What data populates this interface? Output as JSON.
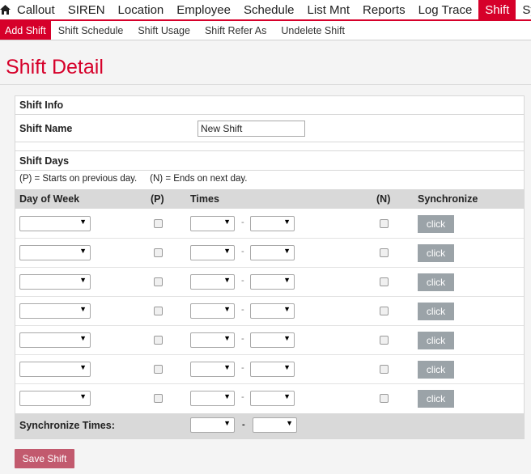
{
  "nav": {
    "home_icon": "home-icon",
    "items": [
      {
        "label": "Callout",
        "active": false
      },
      {
        "label": "SIREN",
        "active": false
      },
      {
        "label": "Location",
        "active": false
      },
      {
        "label": "Employee",
        "active": false
      },
      {
        "label": "Schedule",
        "active": false
      },
      {
        "label": "List Mnt",
        "active": false
      },
      {
        "label": "Reports",
        "active": false
      },
      {
        "label": "Log Trace",
        "active": false
      },
      {
        "label": "Shift",
        "active": true
      },
      {
        "label": "Sys Ac",
        "active": false
      }
    ]
  },
  "subnav": {
    "items": [
      {
        "label": "Add Shift",
        "active": true
      },
      {
        "label": "Shift Schedule",
        "active": false
      },
      {
        "label": "Shift Usage",
        "active": false
      },
      {
        "label": "Shift Refer As",
        "active": false
      },
      {
        "label": "Undelete Shift",
        "active": false
      }
    ]
  },
  "page": {
    "title": "Shift Detail"
  },
  "shift_info": {
    "heading": "Shift Info",
    "name_label": "Shift Name",
    "name_value": "New Shift"
  },
  "shift_days": {
    "heading": "Shift Days",
    "note": "(P) = Starts on previous day.     (N) = Ends on next day.",
    "columns": {
      "day": "Day of Week",
      "p": "(P)",
      "times": "Times",
      "n": "(N)",
      "sync": "Synchronize"
    },
    "time_separator": "-",
    "rows": [
      {
        "day": "",
        "start": "",
        "end": "",
        "p": false,
        "n": false,
        "button": "click"
      },
      {
        "day": "",
        "start": "",
        "end": "",
        "p": false,
        "n": false,
        "button": "click"
      },
      {
        "day": "",
        "start": "",
        "end": "",
        "p": false,
        "n": false,
        "button": "click"
      },
      {
        "day": "",
        "start": "",
        "end": "",
        "p": false,
        "n": false,
        "button": "click"
      },
      {
        "day": "",
        "start": "",
        "end": "",
        "p": false,
        "n": false,
        "button": "click"
      },
      {
        "day": "",
        "start": "",
        "end": "",
        "p": false,
        "n": false,
        "button": "click"
      },
      {
        "day": "",
        "start": "",
        "end": "",
        "p": false,
        "n": false,
        "button": "click"
      }
    ],
    "sync_label": "Synchronize Times:",
    "sync_separator": "-"
  },
  "actions": {
    "save_label": "Save Shift"
  },
  "colors": {
    "accent": "#d6002a",
    "button_gray": "#9ba3a8",
    "save": "#c25a6e"
  }
}
